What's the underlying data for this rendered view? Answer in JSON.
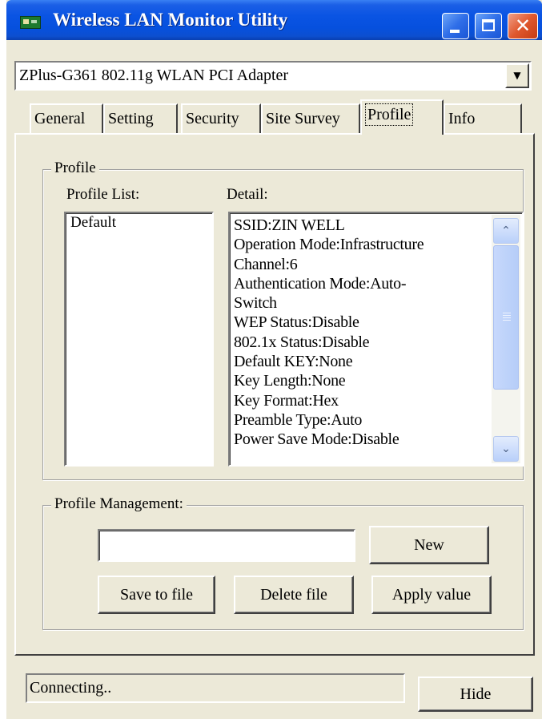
{
  "window": {
    "title": "Wireless LAN Monitor Utility",
    "controls": [
      "minimize",
      "maximize",
      "close"
    ],
    "close_glyph": "✕"
  },
  "adapter": {
    "selected": "ZPlus-G361 802.11g WLAN PCI Adapter",
    "arrow": "▼"
  },
  "tabs": [
    {
      "label": "General"
    },
    {
      "label": "Setting"
    },
    {
      "label": "Security"
    },
    {
      "label": "Site Survey"
    },
    {
      "label": "Profile"
    },
    {
      "label": "Info"
    }
  ],
  "active_tab": "Profile",
  "profile": {
    "group_title": "Profile",
    "list_label": "Profile List:",
    "detail_label": "Detail:",
    "list_items": [
      "Default"
    ],
    "detail_lines": [
      "SSID:ZIN WELL",
      "Operation Mode:Infrastructure",
      "Channel:6",
      "Authentication Mode:Auto-",
      "Switch",
      "WEP Status:Disable",
      "802.1x Status:Disable",
      "Default KEY:None",
      "Key Length:None",
      "Key Format:Hex",
      "Preamble Type:Auto",
      "Power Save Mode:Disable"
    ],
    "scroll_up": "⌃",
    "scroll_down": "⌄"
  },
  "management": {
    "group_title": "Profile Management:",
    "name_input_value": "",
    "new_label": "New",
    "save_label": "Save to file",
    "delete_label": "Delete file",
    "apply_label": "Apply value"
  },
  "status": {
    "text": "Connecting..",
    "hide_label": "Hide"
  },
  "colors": {
    "titlebar": "#0a54e3",
    "face": "#ece9d8",
    "close_button": "#e0582e"
  }
}
